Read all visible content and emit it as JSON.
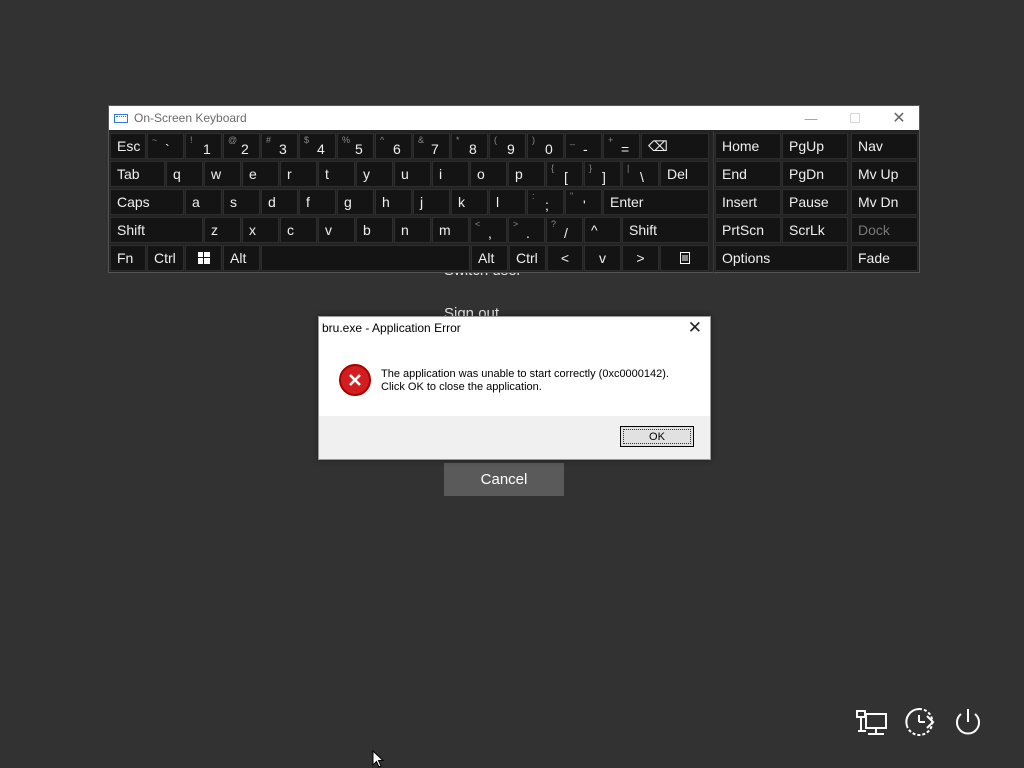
{
  "background_menu": {
    "switch_user": "Switch user",
    "sign_out": "Sign out",
    "cancel": "Cancel"
  },
  "osk": {
    "title": "On-Screen Keyboard",
    "min_glyph": "—",
    "close_glyph": "✕",
    "row1": [
      {
        "label": "Esc"
      },
      {
        "up": "~",
        "dn": "`"
      },
      {
        "up": "!",
        "dn": "1"
      },
      {
        "up": "@",
        "dn": "2"
      },
      {
        "up": "#",
        "dn": "3"
      },
      {
        "up": "$",
        "dn": "4"
      },
      {
        "up": "%",
        "dn": "5"
      },
      {
        "up": "^",
        "dn": "6"
      },
      {
        "up": "&",
        "dn": "7"
      },
      {
        "up": "*",
        "dn": "8"
      },
      {
        "up": "(",
        "dn": "9"
      },
      {
        "up": ")",
        "dn": "0"
      },
      {
        "up": "_",
        "dn": "-"
      },
      {
        "up": "+",
        "dn": "="
      },
      {
        "label": "⌫"
      }
    ],
    "row2": [
      "Tab",
      "q",
      "w",
      "e",
      "r",
      "t",
      "y",
      "u",
      "i",
      "o",
      "p"
    ],
    "row2_brackets": [
      {
        "up": "{",
        "dn": "["
      },
      {
        "up": "}",
        "dn": "]"
      },
      {
        "up": "|",
        "dn": "\\"
      }
    ],
    "row2_del": "Del",
    "row3": [
      "Caps",
      "a",
      "s",
      "d",
      "f",
      "g",
      "h",
      "j",
      "k",
      "l"
    ],
    "row3_punct": [
      {
        "up": ":",
        "dn": ";"
      },
      {
        "up": "\"",
        "dn": "'"
      }
    ],
    "row3_enter": "Enter",
    "row4": [
      "Shift",
      "z",
      "x",
      "c",
      "v",
      "b",
      "n",
      "m"
    ],
    "row4_punct": [
      {
        "up": "<",
        "dn": ","
      },
      {
        "up": ">",
        "dn": "."
      },
      {
        "up": "?",
        "dn": "/"
      }
    ],
    "row4_up": "^",
    "row4_shift": "Shift",
    "row5": {
      "fn": "Fn",
      "ctrl": "Ctrl",
      "alt": "Alt",
      "alt_r": "Alt",
      "ctrl_r": "Ctrl",
      "left": "<",
      "down": "v",
      "right": ">"
    },
    "nav_keys": {
      "home": "Home",
      "pgup": "PgUp",
      "nav": "Nav",
      "end": "End",
      "pgdn": "PgDn",
      "mvup": "Mv Up",
      "insert": "Insert",
      "pause": "Pause",
      "mvdn": "Mv Dn",
      "prtscn": "PrtScn",
      "scrlk": "ScrLk",
      "dock": "Dock",
      "options": "Options",
      "fade": "Fade"
    }
  },
  "dialog": {
    "title": "bru.exe - Application Error",
    "message_line1": "The application was unable to start correctly (0xc0000142).",
    "message_line2": "Click OK to close the application.",
    "ok_label": "OK",
    "close_glyph": "✕"
  },
  "colors": {
    "background": "#323232",
    "key_bg": "#141414",
    "error_red": "#d21e1e",
    "accent_blue": "#2f7bd6"
  }
}
